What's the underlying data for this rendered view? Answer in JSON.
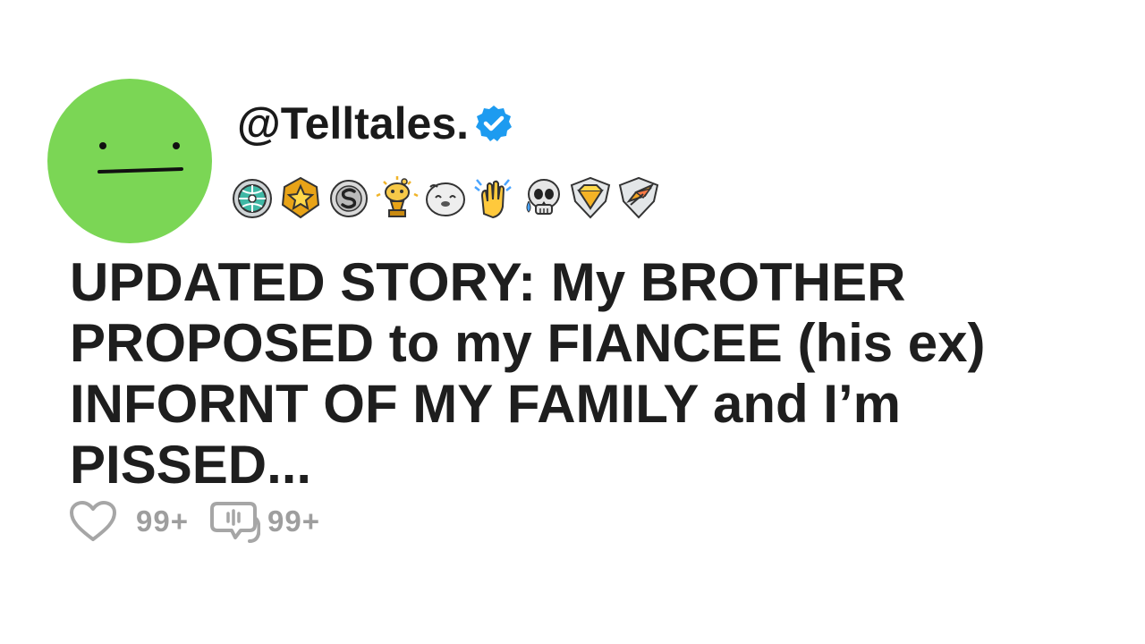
{
  "post": {
    "username": "@Telltales.",
    "verified": true,
    "title": "UPDATED STORY: My BROTHER PROPOSED to my FIANCEE (his ex) INFORNT OF MY FAMILY and I’m PISSED...",
    "likes": "99+",
    "comments": "99+"
  },
  "colors": {
    "avatar": "#7bd655",
    "verified": "#1d9bf0",
    "title_text": "#1e1e1e",
    "stat_text": "#9e9e9e"
  },
  "badges": [
    "globe-award-icon",
    "star-award-icon",
    "silver-s-award-icon",
    "gold-snoo-trophy-icon",
    "wholesome-seal-icon",
    "clapping-hands-icon",
    "crying-skull-icon",
    "gold-diamond-shield-icon",
    "platinum-feather-shield-icon"
  ],
  "icons": {
    "likes": "heart-icon",
    "comments": "comment-icon"
  }
}
